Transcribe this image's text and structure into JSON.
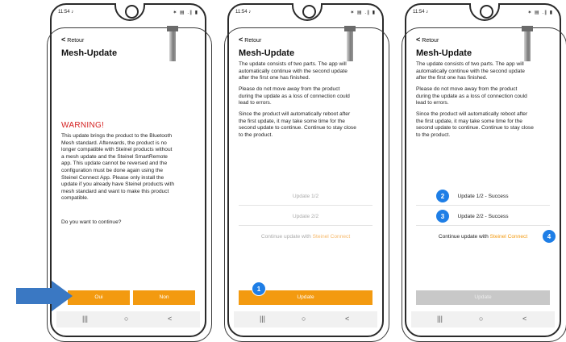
{
  "status_bar": {
    "time": "11:54 ♪",
    "icons": "✶ ▤ .∥ ▮"
  },
  "screens": [
    {
      "back_label": "Retour",
      "title": "Mesh-Update",
      "warning_title": "WARNING!",
      "warning_lines": [
        "This update brings the product to the Bluetooth",
        "Mesh standard. Afterwards, the product is no",
        "longer compatible with Steinel products without",
        "a mesh update and the Steinel SmartRemote",
        "app. This update cannot be reversed and the",
        "configuration must be done again using the",
        "Steinel Connect App. Please only install the",
        "update if you already have Steinel products with",
        "mesh standard and want to make this product",
        "compatible."
      ],
      "question": "Do you want to continue?",
      "yes_button": "Oui",
      "no_button": "Non"
    },
    {
      "back_label": "Retour",
      "title": "Mesh-Update",
      "paragraphs": [
        [
          "The update consists of two parts. The app will",
          "automatically continue with the second update",
          "after the first one has finished."
        ],
        [
          "Please do not move away from the product",
          "during the update as a loss of connection could",
          "lead to errors."
        ],
        [
          "Since the product will automatically reboot after",
          "the first update, it may take some time for the",
          "second update to continue. Continue to stay close",
          "to the product."
        ]
      ],
      "update1": "Update 1/2",
      "update2": "Update 2/2",
      "continue_prefix": "Continue update with ",
      "continue_link": "Steinel Connect",
      "update_button": "Update",
      "badge": "1"
    },
    {
      "back_label": "Retour",
      "title": "Mesh-Update",
      "paragraphs": [
        [
          "The update consists of two parts. The app will",
          "automatically continue with the second update",
          "after the first one has finished."
        ],
        [
          "Please do not move away from the product",
          "during the update as a loss of connection could",
          "lead to errors."
        ],
        [
          "Since the product will automatically reboot after",
          "the first update, it may take some time for the",
          "second update to continue. Continue to stay close",
          "to the product."
        ]
      ],
      "update1": "Update 1/2 - Success",
      "update2": "Update 2/2 - Success",
      "continue_prefix": "Continue update with ",
      "continue_link": "Steinel Connect",
      "update_button": "Update",
      "badges": [
        "2",
        "3",
        "4"
      ]
    }
  ],
  "nav": {
    "recent": "|||",
    "home": "○",
    "back": "<"
  },
  "colors": {
    "accent": "#f39a10",
    "badge": "#1e7ee6",
    "warning": "#d42020",
    "arrow": "#3a78c3"
  }
}
